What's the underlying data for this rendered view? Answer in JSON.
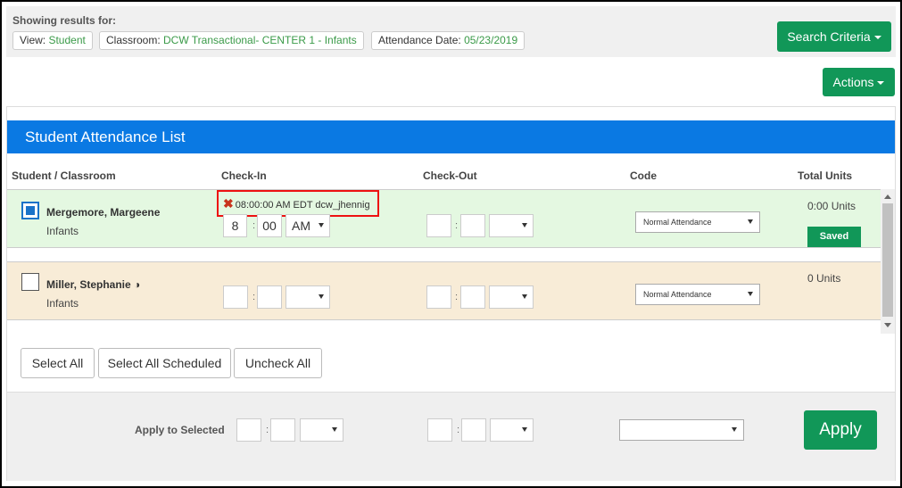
{
  "results": {
    "heading": "Showing results for:",
    "chips": [
      {
        "label": "View: ",
        "value": "Student"
      },
      {
        "label": "Classroom: ",
        "value": "DCW Transactional- CENTER 1 - Infants"
      },
      {
        "label": "Attendance Date: ",
        "value": "05/23/2019"
      }
    ]
  },
  "buttons": {
    "search_criteria": "Search Criteria",
    "actions": "Actions",
    "select_all": "Select All",
    "select_all_scheduled": "Select All Scheduled",
    "uncheck_all": "Uncheck All",
    "apply": "Apply"
  },
  "panel": {
    "title": "Student Attendance List",
    "columns": [
      "Student / Classroom",
      "Check-In",
      "Check-Out",
      "Code",
      "Total Units"
    ]
  },
  "rows": [
    {
      "name": "Mergemore, Margeene",
      "classroom": "Infants",
      "checked": true,
      "checkin_audit": "08:00:00 AM EDT dcw_jhennig",
      "checkin_hour": "8",
      "checkin_minute": "00",
      "checkin_ampm": "AM",
      "checkout_hour": "",
      "checkout_minute": "",
      "checkout_ampm": "",
      "code": "Normal Attendance",
      "units": "0:00 Units",
      "status": "Saved"
    },
    {
      "name": "Miller, Stephanie",
      "name_icon": "half-circle-icon",
      "classroom": "Infants",
      "checked": false,
      "checkin_hour": "",
      "checkin_minute": "",
      "checkin_ampm": "",
      "checkout_hour": "",
      "checkout_minute": "",
      "checkout_ampm": "",
      "code": "Normal Attendance",
      "units": "0 Units"
    }
  ],
  "apply_bar": {
    "label": "Apply to Selected",
    "code": ""
  },
  "colors": {
    "accent_green": "#119758",
    "header_blue": "#0a79e3",
    "row_saved_bg": "#e4f8e1",
    "row_unsaved_bg": "#f8ecd7",
    "highlight_red": "#e11111"
  }
}
